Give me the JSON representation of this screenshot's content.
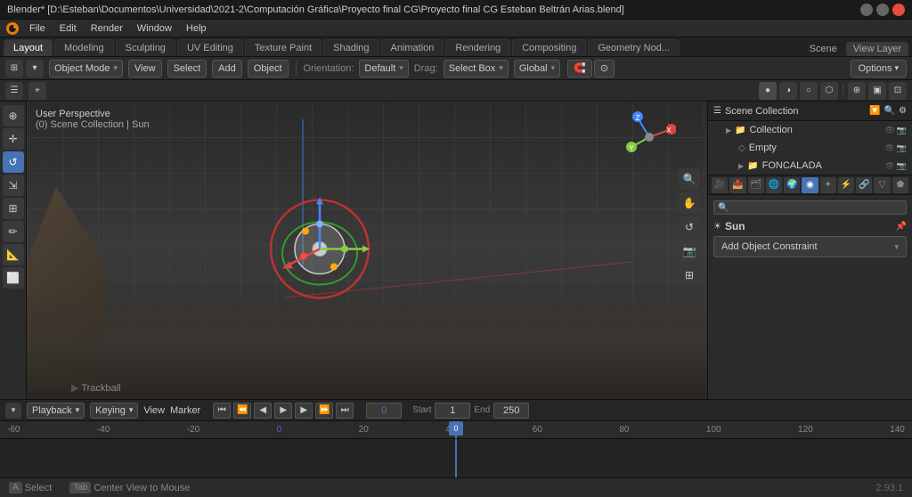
{
  "window": {
    "title": "Blender* [D:\\Esteban\\Documentos\\Universidad\\2021-2\\Computación Gráfica\\Proyecto final CG\\Proyecto final CG Esteban Beltrán Arias.blend]",
    "version": "2.93.1"
  },
  "menu": {
    "items": [
      "Blender",
      "File",
      "Edit",
      "Render",
      "Window",
      "Help"
    ]
  },
  "workspace_tabs": {
    "tabs": [
      "Layout",
      "Modeling",
      "Sculpting",
      "UV Editing",
      "Texture Paint",
      "Shading",
      "Animation",
      "Rendering",
      "Compositing",
      "Geometry Nod..."
    ],
    "active": "Layout"
  },
  "header_toolbar": {
    "mode_label": "Object Mode",
    "view_label": "View",
    "select_label": "Select",
    "add_label": "Add",
    "object_label": "Object",
    "orientation_label": "Orientation:",
    "orientation_value": "Default",
    "drag_label": "Drag:",
    "drag_value": "Select Box",
    "transform_label": "Global",
    "snap_label": "",
    "options_label": "Options"
  },
  "viewport": {
    "perspective_label": "User Perspective",
    "collection_label": "(0) Scene Collection | Sun",
    "trackball_label": "Trackball"
  },
  "outliner": {
    "title": "Scene Collection",
    "search_placeholder": "",
    "items": [
      {
        "name": "Collection",
        "indent": 1,
        "expanded": true,
        "icon": "📁"
      },
      {
        "name": "Empty",
        "indent": 2,
        "icon": "◇"
      },
      {
        "name": "FONCALADA",
        "indent": 2,
        "icon": "📁"
      }
    ]
  },
  "properties": {
    "active_object": "Sun",
    "constraint_label": "Add Object Constraint"
  },
  "timeline": {
    "playback_label": "Playback",
    "keying_label": "Keying",
    "view_label": "View",
    "marker_label": "Marker",
    "current_frame": "0",
    "start_label": "Start",
    "start_value": "1",
    "end_label": "End",
    "end_value": "250",
    "markers": [
      "-60",
      "-40",
      "-20",
      "0",
      "20",
      "40",
      "60",
      "80",
      "100",
      "120",
      "140"
    ]
  },
  "status_bar": {
    "select_label": "Select",
    "center_label": "Center View to Mouse",
    "select_key": "A",
    "center_key": "Tab"
  },
  "view_layer": {
    "label": "View Layer"
  }
}
